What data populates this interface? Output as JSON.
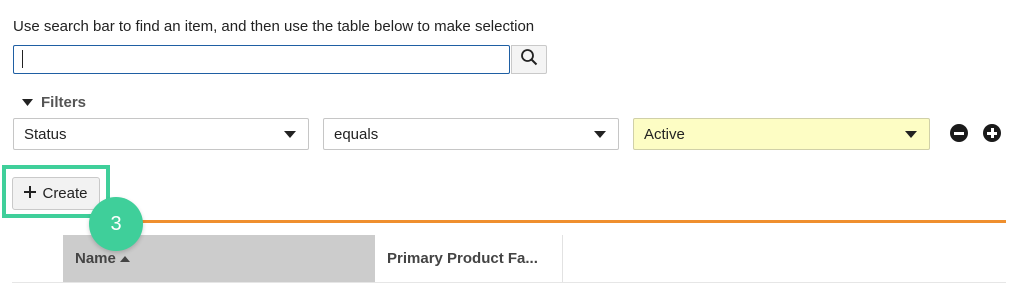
{
  "instruction": "Use search bar to find an item, and then use the table below to make selection",
  "search": {
    "value": "",
    "placeholder": ""
  },
  "filters": {
    "label": "Filters",
    "field": "Status",
    "operator": "equals",
    "value": "Active"
  },
  "toolbar": {
    "create_label": "Create"
  },
  "step_badge": "3",
  "table": {
    "columns": [
      "Name",
      "Primary Product Fa..."
    ],
    "sorted_column": "Name",
    "sort_direction": "ascending"
  },
  "colors": {
    "highlight_outline": "#3fcf9a",
    "accent_line": "#ef8f2e",
    "filter_value_bg": "#fdfdc4",
    "search_border": "#1f5fa3"
  }
}
